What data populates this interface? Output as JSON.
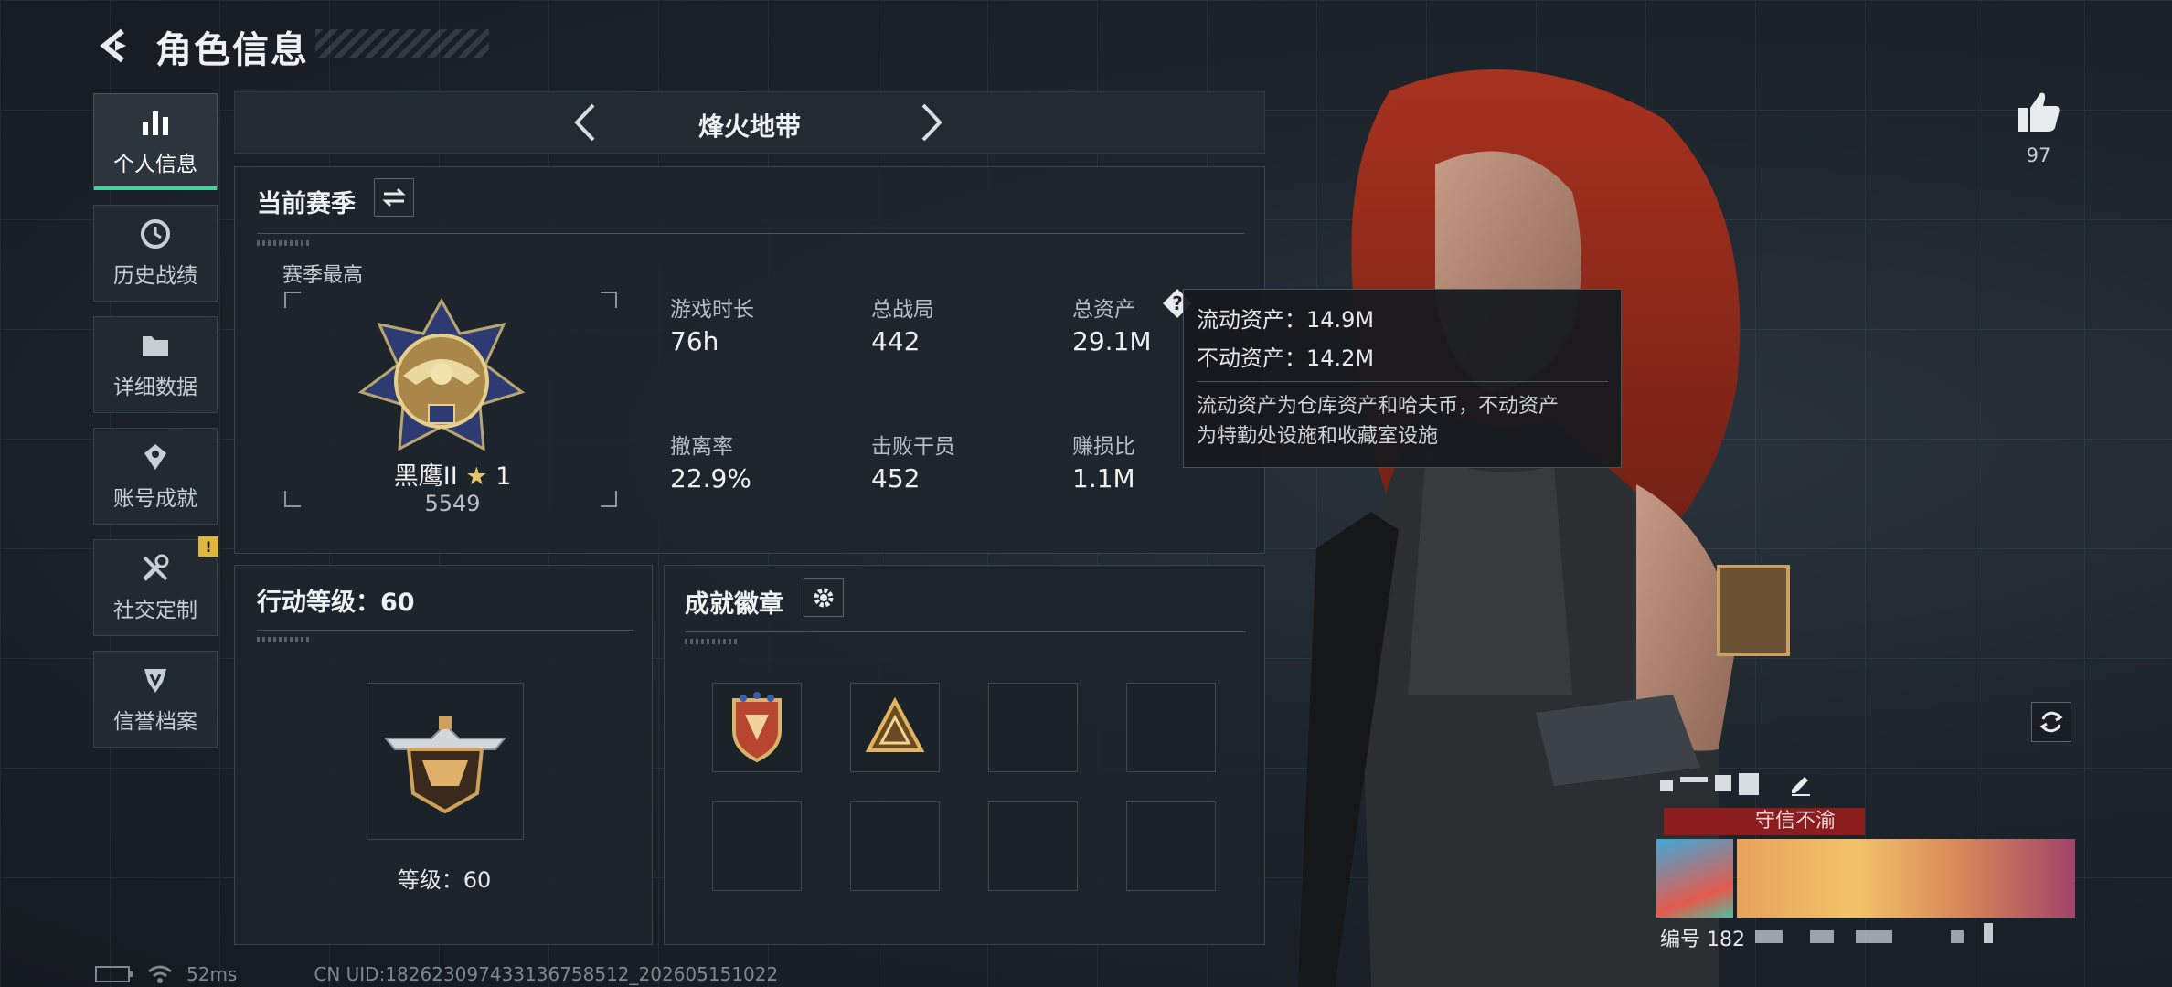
{
  "header": {
    "title": "角色信息"
  },
  "sidebar": {
    "items": [
      {
        "label": "个人信息",
        "active": true
      },
      {
        "label": "历史战绩"
      },
      {
        "label": "详细数据"
      },
      {
        "label": "账号成就"
      },
      {
        "label": "社交定制",
        "badge": "!"
      },
      {
        "label": "信誉档案"
      }
    ]
  },
  "mode": {
    "title": "烽火地带"
  },
  "season": {
    "heading": "当前赛季",
    "best_label": "赛季最高",
    "rank_name": "黑鹰II",
    "rank_stars": "1",
    "rank_score": "5549",
    "stats": [
      {
        "label": "游戏时长",
        "value": "76h"
      },
      {
        "label": "总战局",
        "value": "442"
      },
      {
        "label": "总资产",
        "value": "29.1M"
      },
      {
        "label": "撤离率",
        "value": "22.9%"
      },
      {
        "label": "击败干员",
        "value": "452"
      },
      {
        "label": "赚损比",
        "value": "1.1M"
      }
    ]
  },
  "tooltip": {
    "liquid": "流动资产：14.9M",
    "fixed": "不动资产：14.2M",
    "desc_line1": "流动资产为仓库资产和哈夫币，不动资产",
    "desc_line2": "为特勤处设施和收藏室设施"
  },
  "action_level": {
    "heading": "行动等级：60",
    "level_text": "等级：60"
  },
  "badges": {
    "heading": "成就徽章"
  },
  "profile": {
    "likes": "97",
    "title_ribbon": "守信不渝",
    "id_label": "编号 182"
  },
  "footer": {
    "ping": "52ms",
    "uid": "CN UID:18262309743313675851​2_202605151022"
  },
  "colors": {
    "accent": "#41d39a",
    "warning": "#e0b73c",
    "ribbon": "#8c1d1f"
  },
  "icons": [
    "back-arrow-icon",
    "bar-chart-icon",
    "clock-icon",
    "folder-icon",
    "achievement-icon",
    "wrench-icon",
    "shield-icon",
    "chevron-left-icon",
    "chevron-right-icon",
    "swap-icon",
    "help-icon",
    "gear-icon",
    "thumbs-up-icon",
    "refresh-icon",
    "edit-icon",
    "battery-icon",
    "wifi-icon"
  ]
}
